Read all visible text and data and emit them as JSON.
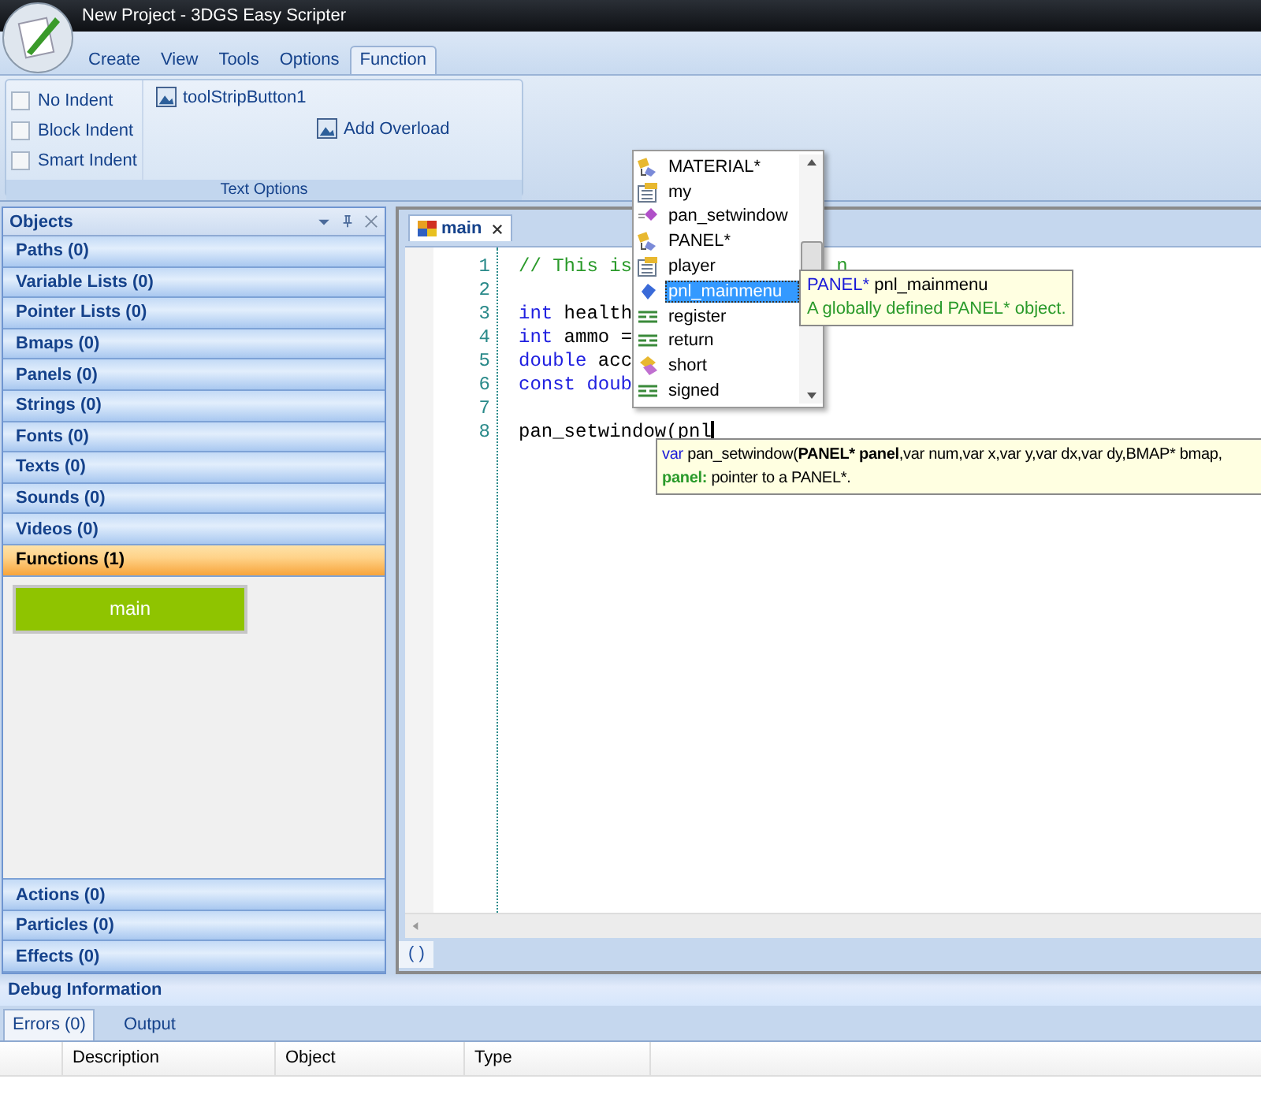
{
  "window": {
    "title": "New Project - 3DGS Easy Scripter"
  },
  "ribbon_tabs": [
    {
      "label": "Create",
      "selected": false
    },
    {
      "label": "View",
      "selected": false
    },
    {
      "label": "Tools",
      "selected": false
    },
    {
      "label": "Options",
      "selected": false
    },
    {
      "label": "Function",
      "selected": true
    }
  ],
  "ribbon_group": {
    "label": "Text Options",
    "options": [
      {
        "label": "No Indent",
        "checked": false
      },
      {
        "label": "Block Indent",
        "checked": false
      },
      {
        "label": "Smart Indent",
        "checked": false
      }
    ],
    "buttons": [
      "toolStripButton1",
      "Add Overload"
    ]
  },
  "objects_panel": {
    "title": "Objects",
    "categories": [
      {
        "label": "Paths (0)",
        "selected": false
      },
      {
        "label": "Variable Lists (0)",
        "selected": false
      },
      {
        "label": "Pointer Lists (0)",
        "selected": false
      },
      {
        "label": "Bmaps (0)",
        "selected": false
      },
      {
        "label": "Panels (0)",
        "selected": false
      },
      {
        "label": "Strings (0)",
        "selected": false
      },
      {
        "label": "Fonts (0)",
        "selected": false
      },
      {
        "label": "Texts (0)",
        "selected": false
      },
      {
        "label": "Sounds (0)",
        "selected": false
      },
      {
        "label": "Videos (0)",
        "selected": false
      },
      {
        "label": "Functions (1)",
        "selected": true,
        "items": [
          "main"
        ]
      },
      {
        "label": "Actions (0)",
        "selected": false
      },
      {
        "label": "Particles (0)",
        "selected": false
      },
      {
        "label": "Effects (0)",
        "selected": false
      }
    ]
  },
  "editor": {
    "tabs": [
      {
        "label": "main",
        "selected": true
      }
    ],
    "lines": [
      {
        "number": "1",
        "tokens": [
          {
            "kind": "comment",
            "text": "// This is"
          }
        ],
        "tail": {
          "kind": "comment",
          "text": "n"
        }
      },
      {
        "number": "2"
      },
      {
        "number": "3",
        "tokens": [
          {
            "kind": "keyword",
            "text": "int"
          },
          {
            "kind": "plain",
            "text": " health"
          }
        ]
      },
      {
        "number": "4",
        "tokens": [
          {
            "kind": "keyword",
            "text": "int"
          },
          {
            "kind": "plain",
            "text": " ammo ="
          }
        ]
      },
      {
        "number": "5",
        "tokens": [
          {
            "kind": "keyword",
            "text": "double"
          },
          {
            "kind": "plain",
            "text": " acc"
          }
        ]
      },
      {
        "number": "6",
        "tokens": [
          {
            "kind": "keyword",
            "text": "const doub"
          }
        ]
      },
      {
        "number": "7"
      },
      {
        "number": "8",
        "tokens": [
          {
            "kind": "plain",
            "text": "pan_setwindow(pnl"
          }
        ]
      }
    ],
    "status": "( )"
  },
  "autocomplete": {
    "items": [
      {
        "label": "MATERIAL*",
        "kind": "type",
        "selected": false
      },
      {
        "label": "my",
        "kind": "struct",
        "selected": false
      },
      {
        "label": "pan_setwindow",
        "kind": "function",
        "selected": false
      },
      {
        "label": "PANEL*",
        "kind": "type",
        "selected": false
      },
      {
        "label": "player",
        "kind": "struct",
        "selected": false
      },
      {
        "label": "pnl_mainmenu",
        "kind": "variable",
        "selected": true
      },
      {
        "label": "register",
        "kind": "keyword",
        "selected": false
      },
      {
        "label": "return",
        "kind": "keyword",
        "selected": false
      },
      {
        "label": "short",
        "kind": "primitive",
        "selected": false
      },
      {
        "label": "signed",
        "kind": "keyword",
        "selected": false
      }
    ]
  },
  "member_tooltip": {
    "type": "PANEL*",
    "name": "pnl_mainmenu",
    "description": "A globally defined PANEL* object."
  },
  "parameter_tooltip": {
    "return_type": "var",
    "signature": "pan_setwindow(**PANEL* panel**,var num,var x,var y,var dx,var dy,BMAP* bmap,",
    "parameter": "panel:",
    "description": "pointer to a PANEL*."
  },
  "debug_panel": {
    "title": "Debug Information",
    "tabs": [
      {
        "label": "Errors (0)",
        "selected": true
      },
      {
        "label": "Output",
        "selected": false
      }
    ],
    "columns": [
      "Description",
      "Object",
      "Type"
    ]
  }
}
